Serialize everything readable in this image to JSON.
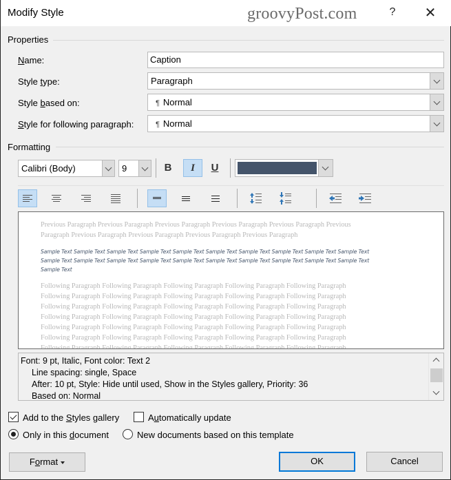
{
  "window": {
    "title": "Modify Style",
    "watermark": "groovyPost.com",
    "help_label": "?",
    "close_label": "✕"
  },
  "properties": {
    "section_label": "Properties",
    "name": {
      "label_pre": "",
      "label_u": "N",
      "label_post": "ame:",
      "value": "Caption"
    },
    "style_type": {
      "label_pre": "Style ",
      "label_u": "t",
      "label_post": "ype:",
      "value": "Paragraph"
    },
    "style_based_on": {
      "label_pre": "Style ",
      "label_u": "b",
      "label_post": "ased on:",
      "pilcrow": "¶",
      "value": "Normal"
    },
    "style_following": {
      "label_pre": "",
      "label_u": "S",
      "label_post": "tyle for following paragraph:",
      "pilcrow": "¶",
      "value": "Normal"
    }
  },
  "formatting": {
    "section_label": "Formatting",
    "font_name": "Calibri (Body)",
    "font_size": "9",
    "bold_label": "B",
    "italic_label": "I",
    "underline_label": "U",
    "bold_active": false,
    "italic_active": true,
    "underline_active": false,
    "font_color": "#44546a",
    "alignment_buttons": [
      {
        "name": "align-left",
        "active": true
      },
      {
        "name": "align-center",
        "active": false
      },
      {
        "name": "align-right",
        "active": false
      },
      {
        "name": "justify",
        "active": false
      }
    ],
    "spacing_buttons": [
      {
        "name": "single-spacing",
        "active": true
      },
      {
        "name": "one-and-half-spacing",
        "active": false
      },
      {
        "name": "double-spacing",
        "active": false
      }
    ],
    "paragraph_spacing_buttons": [
      "increase-paragraph-spacing",
      "decrease-paragraph-spacing"
    ],
    "indent_buttons": [
      "decrease-indent",
      "increase-indent"
    ]
  },
  "preview": {
    "previous_lines": [
      "Previous Paragraph Previous Paragraph Previous Paragraph Previous Paragraph Previous Paragraph Previous",
      "Paragraph Previous Paragraph Previous Paragraph Previous Paragraph Previous Paragraph"
    ],
    "sample_lines": [
      "Sample Text Sample Text Sample Text Sample Text Sample Text Sample Text Sample Text Sample Text Sample Text Sample Text",
      "Sample Text Sample Text Sample Text Sample Text Sample Text Sample Text Sample Text Sample Text Sample Text Sample Text",
      "Sample Text"
    ],
    "following_lines": [
      "Following Paragraph Following Paragraph Following Paragraph Following Paragraph Following Paragraph",
      "Following Paragraph Following Paragraph Following Paragraph Following Paragraph Following Paragraph",
      "Following Paragraph Following Paragraph Following Paragraph Following Paragraph Following Paragraph",
      "Following Paragraph Following Paragraph Following Paragraph Following Paragraph Following Paragraph",
      "Following Paragraph Following Paragraph Following Paragraph Following Paragraph Following Paragraph",
      "Following Paragraph Following Paragraph Following Paragraph Following Paragraph Following Paragraph",
      "Following Paragraph Following Paragraph Following Paragraph Following Paragraph Following Paragraph"
    ]
  },
  "description": {
    "lines": [
      "Font: 9 pt, Italic, Font color: Text 2",
      "Line spacing:  single, Space",
      "After:  10 pt, Style: Hide until used, Show in the Styles gallery, Priority: 36",
      "Based on: Normal"
    ]
  },
  "options": {
    "add_to_gallery": {
      "label_pre": "Add to the ",
      "label_u": "S",
      "label_post": "tyles gallery",
      "checked": true
    },
    "auto_update": {
      "label_pre": "A",
      "label_u": "u",
      "label_post": "tomatically update",
      "checked": false
    },
    "only_this_document": {
      "label_pre": "Only in this ",
      "label_u": "d",
      "label_post": "ocument",
      "selected": true
    },
    "new_documents": {
      "label": "New documents based on this template",
      "selected": false
    }
  },
  "buttons": {
    "format": {
      "label_pre": "F",
      "label_u": "o",
      "label_post": "rmat"
    },
    "ok": "OK",
    "cancel": "Cancel"
  }
}
